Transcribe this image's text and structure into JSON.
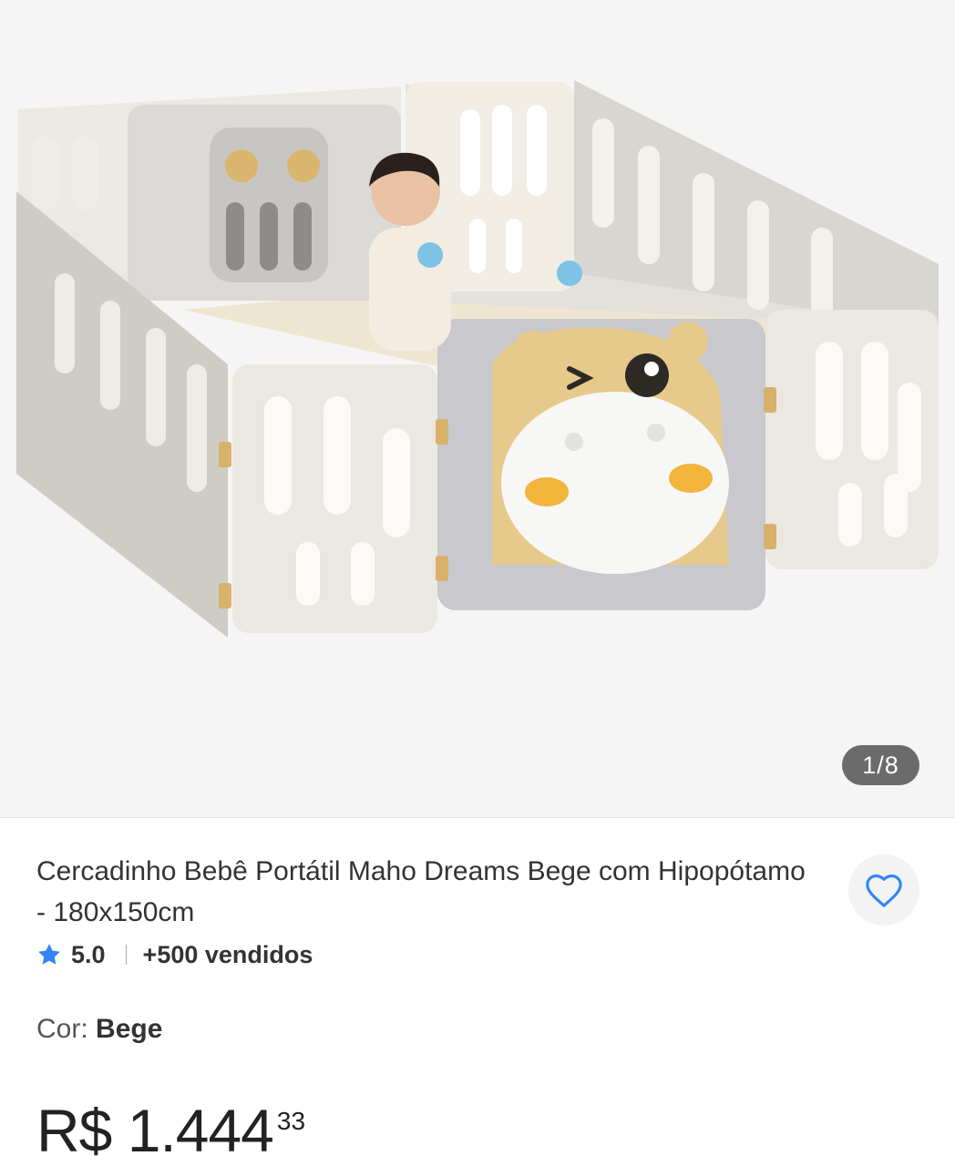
{
  "gallery": {
    "counter": "1/8"
  },
  "product": {
    "title": "Cercadinho Bebê Portátil Maho Dreams Bege com Hipopótamo - 180x150cm",
    "rating": "5.0",
    "sold": "+500 vendidos",
    "color_label": "Cor:",
    "color_value": "Bege",
    "price_main": "R$ 1.444",
    "price_cents": "33"
  },
  "icons": {
    "favorite": "heart-icon",
    "rating": "star-icon"
  },
  "colors": {
    "accent": "#3483fa",
    "text": "#333333"
  }
}
